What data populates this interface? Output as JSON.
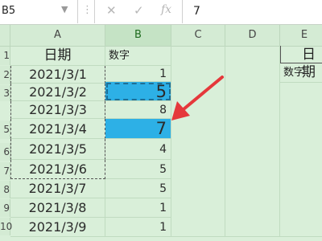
{
  "formula_bar": {
    "name_box": "B5",
    "formula_value": "7",
    "cancel_icon": "x-icon",
    "confirm_icon": "check-icon",
    "function_icon": "fx"
  },
  "columns": [
    "A",
    "B",
    "C",
    "D",
    "E"
  ],
  "row_labels": [
    "1",
    "2",
    "3",
    "5",
    "6",
    "7",
    "8",
    "9",
    "10"
  ],
  "column_a": [
    "日期",
    "2021/3/1",
    "2021/3/2",
    "2021/3/3",
    "2021/3/4",
    "2021/3/5",
    "2021/3/6",
    "2021/3/7",
    "2021/3/8",
    "2021/3/9"
  ],
  "column_b": [
    "数字",
    "1",
    "5",
    "8",
    "7",
    "4",
    "5",
    "5",
    "1",
    "1"
  ],
  "column_e": [
    "日期",
    "数字"
  ],
  "colors": {
    "sheet_bg": "#d9efd9",
    "selection_fill": "#2db0e6",
    "arrow": "#e5383b"
  }
}
